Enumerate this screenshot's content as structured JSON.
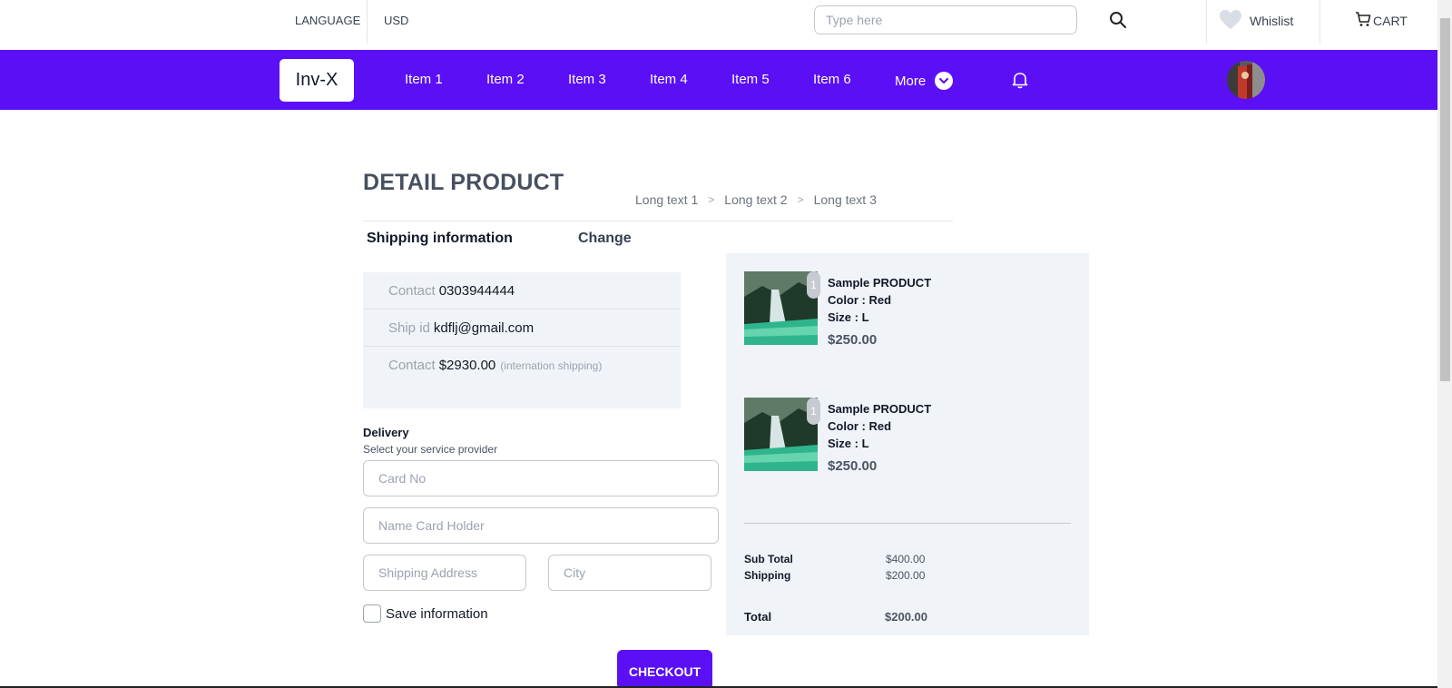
{
  "topbar": {
    "language": "LANGUAGE",
    "currency": "USD",
    "search_placeholder": "Type here",
    "wishlist": "Whislist",
    "cart": "CART"
  },
  "nav": {
    "logo": "Inv-X",
    "items": [
      "Item 1",
      "Item 2",
      "Item 3",
      "Item 4",
      "Item 5",
      "Item 6"
    ],
    "more": "More"
  },
  "page": {
    "title": "DETAIL PRODUCT",
    "breadcrumb": [
      "Long text 1",
      "Long text 2",
      "Long text 3"
    ]
  },
  "shipping": {
    "title": "Shipping information",
    "change": "Change",
    "rows": [
      {
        "label": "Contact",
        "value": "0303944444",
        "note": ""
      },
      {
        "label": "Ship id",
        "value": "kdflj@gmail.com",
        "note": ""
      },
      {
        "label": "Contact",
        "value": "$2930.00",
        "note": "(internation shipping)"
      }
    ]
  },
  "delivery": {
    "title": "Delivery",
    "subtitle": "Select your service provider",
    "card_no_placeholder": "Card No",
    "card_holder_placeholder": "Name Card Holder",
    "address_placeholder": "Shipping Address",
    "city_placeholder": "City",
    "save_label": "Save information",
    "checkout": "CHECKOUT"
  },
  "summary": {
    "products": [
      {
        "qty": "1",
        "name": "Sample PRODUCT",
        "color": "Color : Red",
        "size": "Size : L",
        "price": "$250.00"
      },
      {
        "qty": "1",
        "name": "Sample PRODUCT",
        "color": "Color : Red",
        "size": "Size : L",
        "price": "$250.00"
      }
    ],
    "subtotal_label": "Sub Total",
    "subtotal_value": "$400.00",
    "shipping_label": "Shipping",
    "shipping_value": "$200.00",
    "total_label": "Total",
    "total_value": "$200.00"
  },
  "colors": {
    "accent": "#5b0ff5",
    "panel": "#f0f3f8"
  },
  "icons": {
    "search": "search-icon",
    "wishlist": "heart-icon",
    "cart": "cart-icon",
    "more": "chevron-down-icon",
    "bell": "bell-icon"
  }
}
